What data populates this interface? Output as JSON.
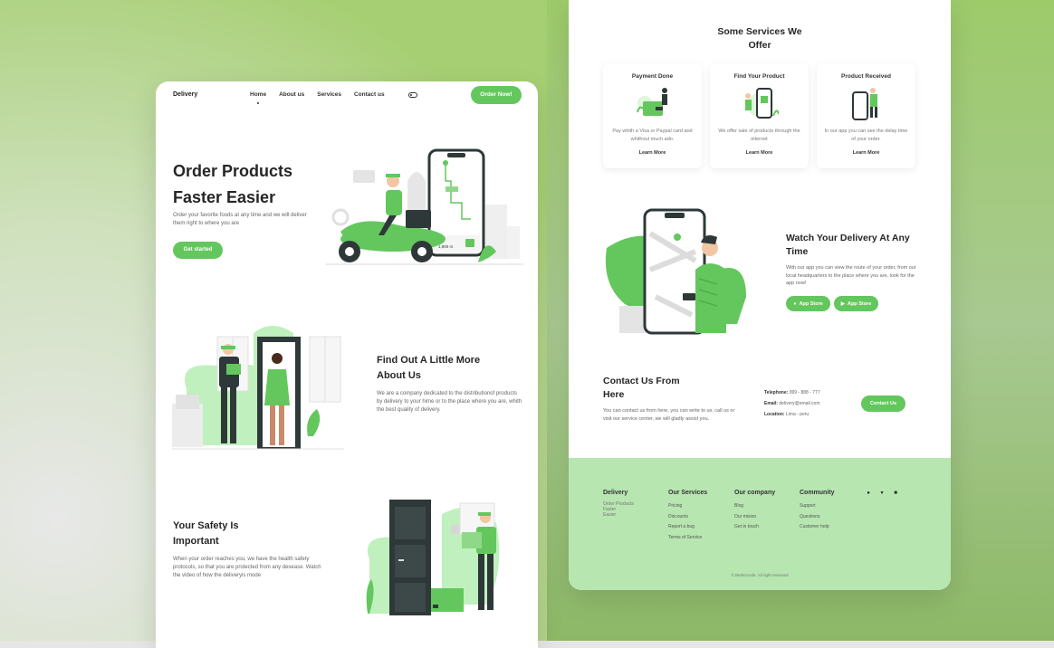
{
  "colors": {
    "accent": "#63c75d",
    "dark": "#2f3838",
    "footer_bg": "#b7e6b1"
  },
  "left": {
    "nav": {
      "brand": "Delivery",
      "links": [
        "Home",
        "About us",
        "Services",
        "Contact us"
      ],
      "cta": "Order Now!"
    },
    "hero": {
      "title_line1": "Order Products",
      "title_line2": "Faster Easier",
      "description": "Order your favorite foods at any time and we will deliver them right to where you are",
      "button": "Get started",
      "phone_price": "1,900 rs"
    },
    "about": {
      "title_line1": "Find Out A Little More",
      "title_line2": "About Us",
      "description": "We are a company dedicated to the distributionof products by delivery to your hime or to the place where you are, whith the best quality of delivery."
    },
    "safety": {
      "title_line1": "Your Safety Is",
      "title_line2": "Important",
      "description": "When your order reaches you, we have the health safety protocols, so that you are protected from any desease. Watch the video of how the deliveryis mode"
    }
  },
  "right": {
    "services": {
      "title_line1": "Some Services We",
      "title_line2": "Offer",
      "cards": [
        {
          "title": "Payment Done",
          "description": "Pay whith a Visa or Paypal card and whithout much ado.",
          "link": "Learn More"
        },
        {
          "title": "Find Your Product",
          "description": "We offer sale of products through the internet",
          "link": "Learn More"
        },
        {
          "title": "Product Received",
          "description": "In our app you can see the delay time of your order.",
          "link": "Learn More"
        }
      ]
    },
    "watch": {
      "title": "Watch Your Delivery At Any Time",
      "description": "With our app you can view the route of your order, from our local headquarters to the place where you are, look for the app now!",
      "store_buttons": [
        "App Store",
        "App Store"
      ]
    },
    "contact": {
      "title_line1": "Contact Us From",
      "title_line2": "Here",
      "description": "You can contact us from here, you can write to us, call us or visit our service center, we will gladly assist you.",
      "telephone_label": "Telephone:",
      "telephone": "999 - 888 - 777",
      "email_label": "Email:",
      "email": "delivery@email.com",
      "location_label": "Location:",
      "location": "Lima - peru",
      "button": "Contact Us"
    },
    "footer": {
      "brand": "Delivery",
      "brand_sub": [
        "Order Products",
        "Faster",
        "Easier"
      ],
      "columns": [
        {
          "heading": "Our Services",
          "items": [
            "Pricing",
            "Discounts",
            "Report a bug",
            "Terms of Service"
          ]
        },
        {
          "heading": "Our company",
          "items": [
            "Blog",
            "Our mision",
            "Get in touch"
          ]
        },
        {
          "heading": "Community",
          "items": [
            "Support",
            "Questions",
            "Customer help"
          ]
        }
      ],
      "socials": [
        "facebook-icon",
        "twitter-icon",
        "instagram-icon"
      ],
      "copyright": "© Bedimcode. All right reserved"
    }
  }
}
